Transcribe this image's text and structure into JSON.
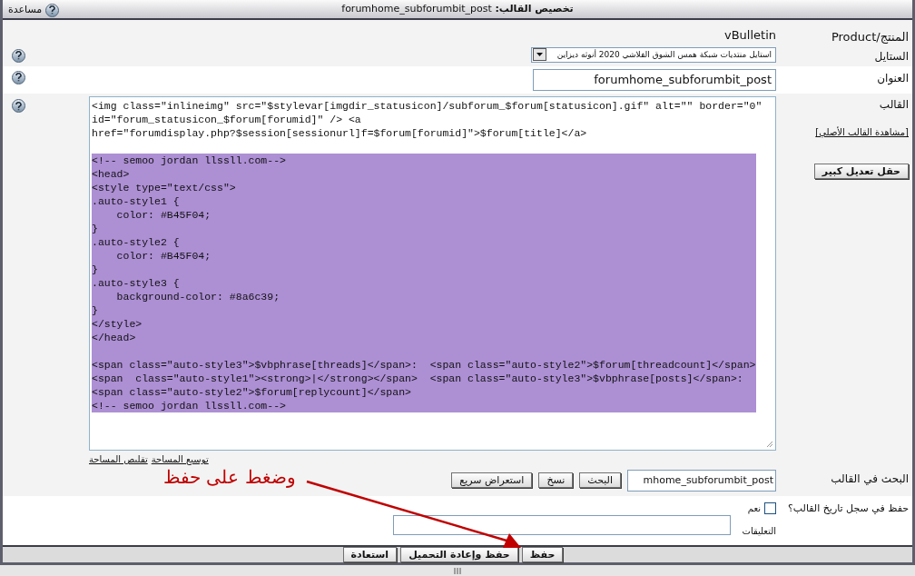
{
  "window": {
    "title": "**تخصيص القالب:** forumhome_subforumbit_post",
    "help": "مساعدة"
  },
  "product": {
    "label": "المنتج/Product",
    "value": "vBulletin"
  },
  "style": {
    "label": "الستايل",
    "value": "استايل منتديات شبكة همس الشوق الفلاشي 2020 أنوثه ديزاين"
  },
  "title_field": {
    "label": "العنوان",
    "value": "forumhome_subforumbit_post"
  },
  "template": {
    "label": "القالب",
    "view_original": "[مشاهدة القالب الأصلي]",
    "large_editor": "حقل تعديل كبير",
    "blocks": [
      {
        "selected": false,
        "lines": [
          "<img class=\"inlineimg\" src=\"$stylevar[imgdir_statusicon]/subforum_$forum[statusicon].gif\" alt=\"\" border=\"0\"",
          "id=\"forum_statusicon_$forum[forumid]\" /> <a",
          "href=\"forumdisplay.php?$session[sessionurl]f=$forum[forumid]\">$forum[title]</a>"
        ]
      },
      {
        "selected": true,
        "lines": [
          "<!-- semoo jordan llssll.com-->",
          "<head>",
          "<style type=\"text/css\">",
          ".auto-style1 {",
          "    color: #B45F04;",
          "}",
          ".auto-style2 {",
          "    color: #B45F04;",
          "}",
          ".auto-style3 {",
          "    background-color: #8a6c39;",
          "}",
          "</style>",
          "</head>"
        ]
      },
      {
        "selected": true,
        "lines": [
          "<span class=\"auto-style3\">$vbphrase[threads]</span>:  <span class=\"auto-style2\">$forum[threadcount]</span>",
          "<span  class=\"auto-style1\"><strong>|</strong></span>  <span class=\"auto-style3\">$vbphrase[posts]</span>:",
          "<span class=\"auto-style2\">$forum[replycount]</span>",
          "<!-- semoo jordan llssll.com-->"
        ]
      }
    ],
    "expand": "توسيع المساحة",
    "shrink": "تقليص المساحة"
  },
  "search": {
    "label": "البحث في القالب",
    "value": "mhome_subforumbit_post",
    "buttons": [
      "البحث",
      "نسخ",
      "استعراض سريع"
    ]
  },
  "history": {
    "label": "حفظ في سجل تاريخ القالب؟",
    "checked": false,
    "yes": "نعم",
    "comments_label": "التعليقات"
  },
  "annotation": "وضغط على حفظ",
  "buttons": [
    "حفظ",
    "حفظ وإعادة التحميل",
    "استعادة"
  ]
}
